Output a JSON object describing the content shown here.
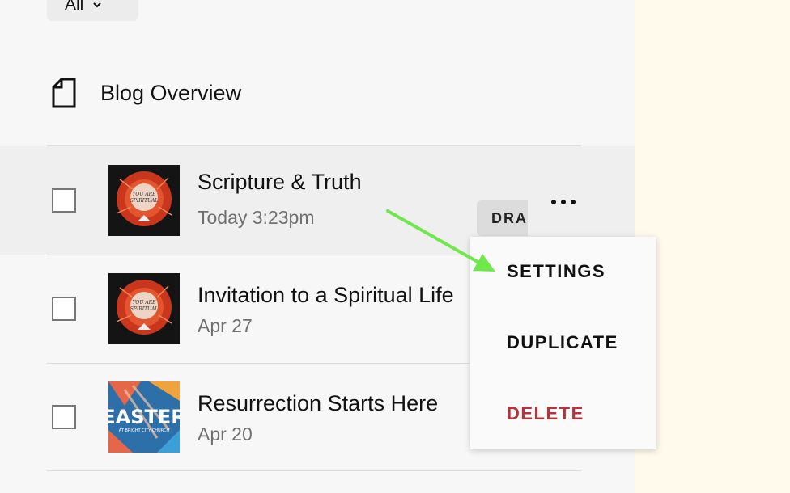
{
  "filter": {
    "label": "All"
  },
  "blog": {
    "title": "Blog Overview"
  },
  "posts": [
    {
      "title": "Scripture & Truth",
      "date": "Today 3:23pm",
      "status": "DRA",
      "thumb_text": [
        "YOU ARE",
        "SPIRITUAL"
      ]
    },
    {
      "title": "Invitation to a Spiritual Life",
      "date": "Apr 27",
      "thumb_text": [
        "YOU ARE",
        "SPIRITUAL"
      ]
    },
    {
      "title": "Resurrection Starts Here",
      "date": "Apr 20",
      "thumb_text": [
        "EASTER",
        "AT BRIGHT CITY CHURCH"
      ]
    }
  ],
  "menu": {
    "settings": "SETTINGS",
    "duplicate": "DUPLICATE",
    "delete": "DELETE"
  },
  "colors": {
    "accent_arrow": "#6fe84c",
    "delete": "#b5333a",
    "background": "#fffaeb"
  }
}
